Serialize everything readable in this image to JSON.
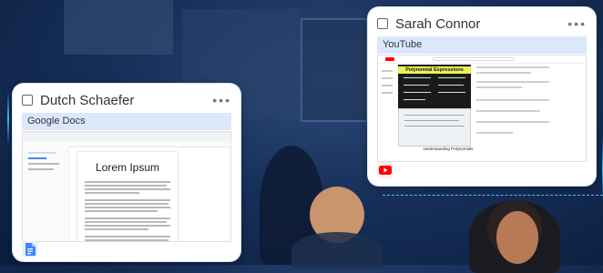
{
  "cards": [
    {
      "student_name": "Dutch Schaefer",
      "tab_title": "Google Docs",
      "menu_label": "•••",
      "app_icon": "google-docs-icon",
      "document_heading": "Lorem Ipsum"
    },
    {
      "student_name": "Sarah Connor",
      "tab_title": "YouTube",
      "menu_label": "•••",
      "app_icon": "youtube-icon",
      "video_title": "Polynomial Expressions",
      "video_caption": "Understanding Polynomials"
    }
  ],
  "colors": {
    "tab_bar_bg": "#dbe8fb",
    "docs_blue": "#4285f4",
    "youtube_red": "#ff0000",
    "accent_line": "#5fb7ff"
  }
}
